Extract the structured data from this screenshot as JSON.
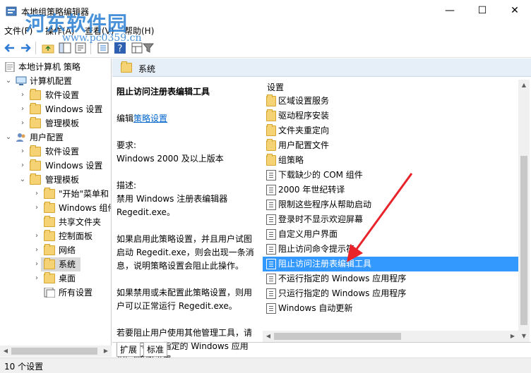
{
  "window": {
    "title": "本地组策略编辑器",
    "controls": {
      "minimize": "—",
      "maximize": "☐",
      "close": "✕"
    }
  },
  "watermark": {
    "text": "河东软件园",
    "url": "www.pc0359.cn"
  },
  "menu": {
    "file": "文件(F)",
    "action": "操作(A)",
    "view": "查看(V)",
    "help": "帮助(H)"
  },
  "tree": {
    "root": "本地计算机 策略",
    "computer_config": "计算机配置",
    "cc_software": "软件设置",
    "cc_windows": "Windows 设置",
    "cc_admin": "管理模板",
    "user_config": "用户配置",
    "uc_software": "软件设置",
    "uc_windows": "Windows 设置",
    "uc_admin": "管理模板",
    "start_menu": "\"开始\"菜单和",
    "windows_comp": "Windows 组件",
    "shared_folders": "共享文件夹",
    "control_panel": "控制面板",
    "network": "网络",
    "system": "系统",
    "desktop": "桌面",
    "all_settings": "所有设置"
  },
  "header": {
    "title": "系统"
  },
  "description": {
    "title": "阻止访问注册表编辑工具",
    "edit_prefix": "编辑",
    "edit_link": "策略设置",
    "requirements_label": "要求:",
    "requirements": "Windows 2000 及以上版本",
    "desc_label": "描述:",
    "desc_text": "禁用 Windows 注册表编辑器 Regedit.exe。",
    "enabled_text": "如果启用此策略设置，并且用户试图启动 Regedit.exe，则会出现一条消息，说明策略设置会阻止此操作。",
    "disabled_text": "如果禁用或未配置此策略设置，则用户可以正常运行 Regedit.exe。",
    "other_text": "若要阻止用户使用其他管理工具，请使用\"只运行指定的 Windows 应用程序\"策略设置。"
  },
  "list": {
    "header": "设置",
    "items": [
      {
        "label": "区域设置服务",
        "type": "folder"
      },
      {
        "label": "驱动程序安装",
        "type": "folder"
      },
      {
        "label": "文件夹重定向",
        "type": "folder"
      },
      {
        "label": "用户配置文件",
        "type": "folder"
      },
      {
        "label": "组策略",
        "type": "folder"
      },
      {
        "label": "下载缺少的 COM 组件",
        "type": "setting"
      },
      {
        "label": "2000 年世纪转译",
        "type": "setting"
      },
      {
        "label": "限制这些程序从帮助启动",
        "type": "setting"
      },
      {
        "label": "登录时不显示欢迎屏幕",
        "type": "setting"
      },
      {
        "label": "自定义用户界面",
        "type": "setting"
      },
      {
        "label": "阻止访问命令提示符",
        "type": "setting"
      },
      {
        "label": "阻止访问注册表编辑工具",
        "type": "setting",
        "selected": true
      },
      {
        "label": "不运行指定的 Windows 应用程序",
        "type": "setting"
      },
      {
        "label": "只运行指定的 Windows 应用程序",
        "type": "setting"
      },
      {
        "label": "Windows 自动更新",
        "type": "setting"
      }
    ]
  },
  "tabs": {
    "extended": "扩展",
    "standard": "标准"
  },
  "status": {
    "text": "10 个设置"
  },
  "colors": {
    "selection": "#3399ff",
    "arrow": "#e8232a",
    "header_bg": "#e6eef8",
    "folder": "#f5d273"
  }
}
